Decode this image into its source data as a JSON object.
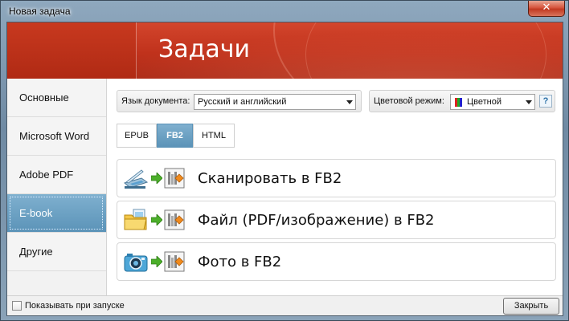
{
  "window": {
    "title": "Новая задача",
    "close_glyph": "✕"
  },
  "banner": {
    "heading": "Задачи"
  },
  "sidebar": {
    "items": [
      {
        "label": "Основные",
        "active": false
      },
      {
        "label": "Microsoft Word",
        "active": false
      },
      {
        "label": "Adobe PDF",
        "active": false
      },
      {
        "label": "E-book",
        "active": true
      },
      {
        "label": "Другие",
        "active": false
      }
    ]
  },
  "toolbar": {
    "language_label": "Язык документа:",
    "language_value": "Русский и английский",
    "color_mode_label": "Цветовой режим:",
    "color_mode_value": "Цветной",
    "help_label": "?"
  },
  "tabs": [
    {
      "label": "EPUB",
      "active": false
    },
    {
      "label": "FB2",
      "active": true
    },
    {
      "label": "HTML",
      "active": false
    }
  ],
  "actions": [
    {
      "label": "Сканировать в FB2",
      "icon": "scanner-icon"
    },
    {
      "label": "Файл (PDF/изображение) в FB2",
      "icon": "folder-icon"
    },
    {
      "label": "Фото в FB2",
      "icon": "camera-icon"
    }
  ],
  "footer": {
    "show_on_startup_label": "Показывать при запуске",
    "show_on_startup_checked": false,
    "close_label": "Закрыть"
  },
  "colors": {
    "banner_red": "#c0321c",
    "active_blue": "#6aa1c4",
    "arrow_green": "#4caf2a",
    "fb_orange": "#f08a1c"
  }
}
